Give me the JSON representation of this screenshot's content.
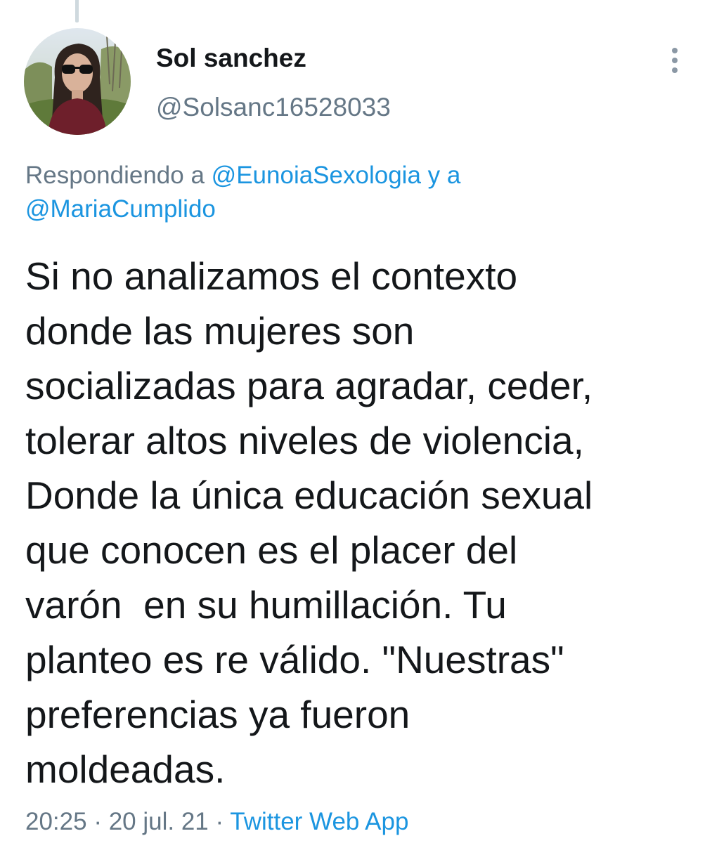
{
  "tweet": {
    "author": {
      "display_name": "Sol sanchez",
      "handle": "@Solsanc16528033"
    },
    "reply_context": {
      "prefix": "Respondiendo a",
      "mention_1": "@EunoiaSexologia",
      "joiner": "y a",
      "mention_2": "@MariaCumplido"
    },
    "text_lines": [
      "Si no analizamos el contexto",
      "donde las mujeres son",
      "socializadas para agradar, ceder,",
      "tolerar altos niveles de violencia,",
      "Donde la única educación sexual",
      "que conocen es el placer del",
      "varón  en su humillación. Tu",
      "planteo es re válido. \"Nuestras\"",
      "preferencias ya fueron",
      "moldeadas."
    ],
    "time": "20:25",
    "separator": "·",
    "date": "20 jul. 21",
    "source": "Twitter Web App"
  },
  "icons": {
    "more": "more-vertical-icon",
    "avatar": "profile-photo"
  },
  "colors": {
    "text_primary": "#14171a",
    "text_secondary": "#657786",
    "link": "#1b95e0",
    "thread_line": "#cfd9de"
  }
}
